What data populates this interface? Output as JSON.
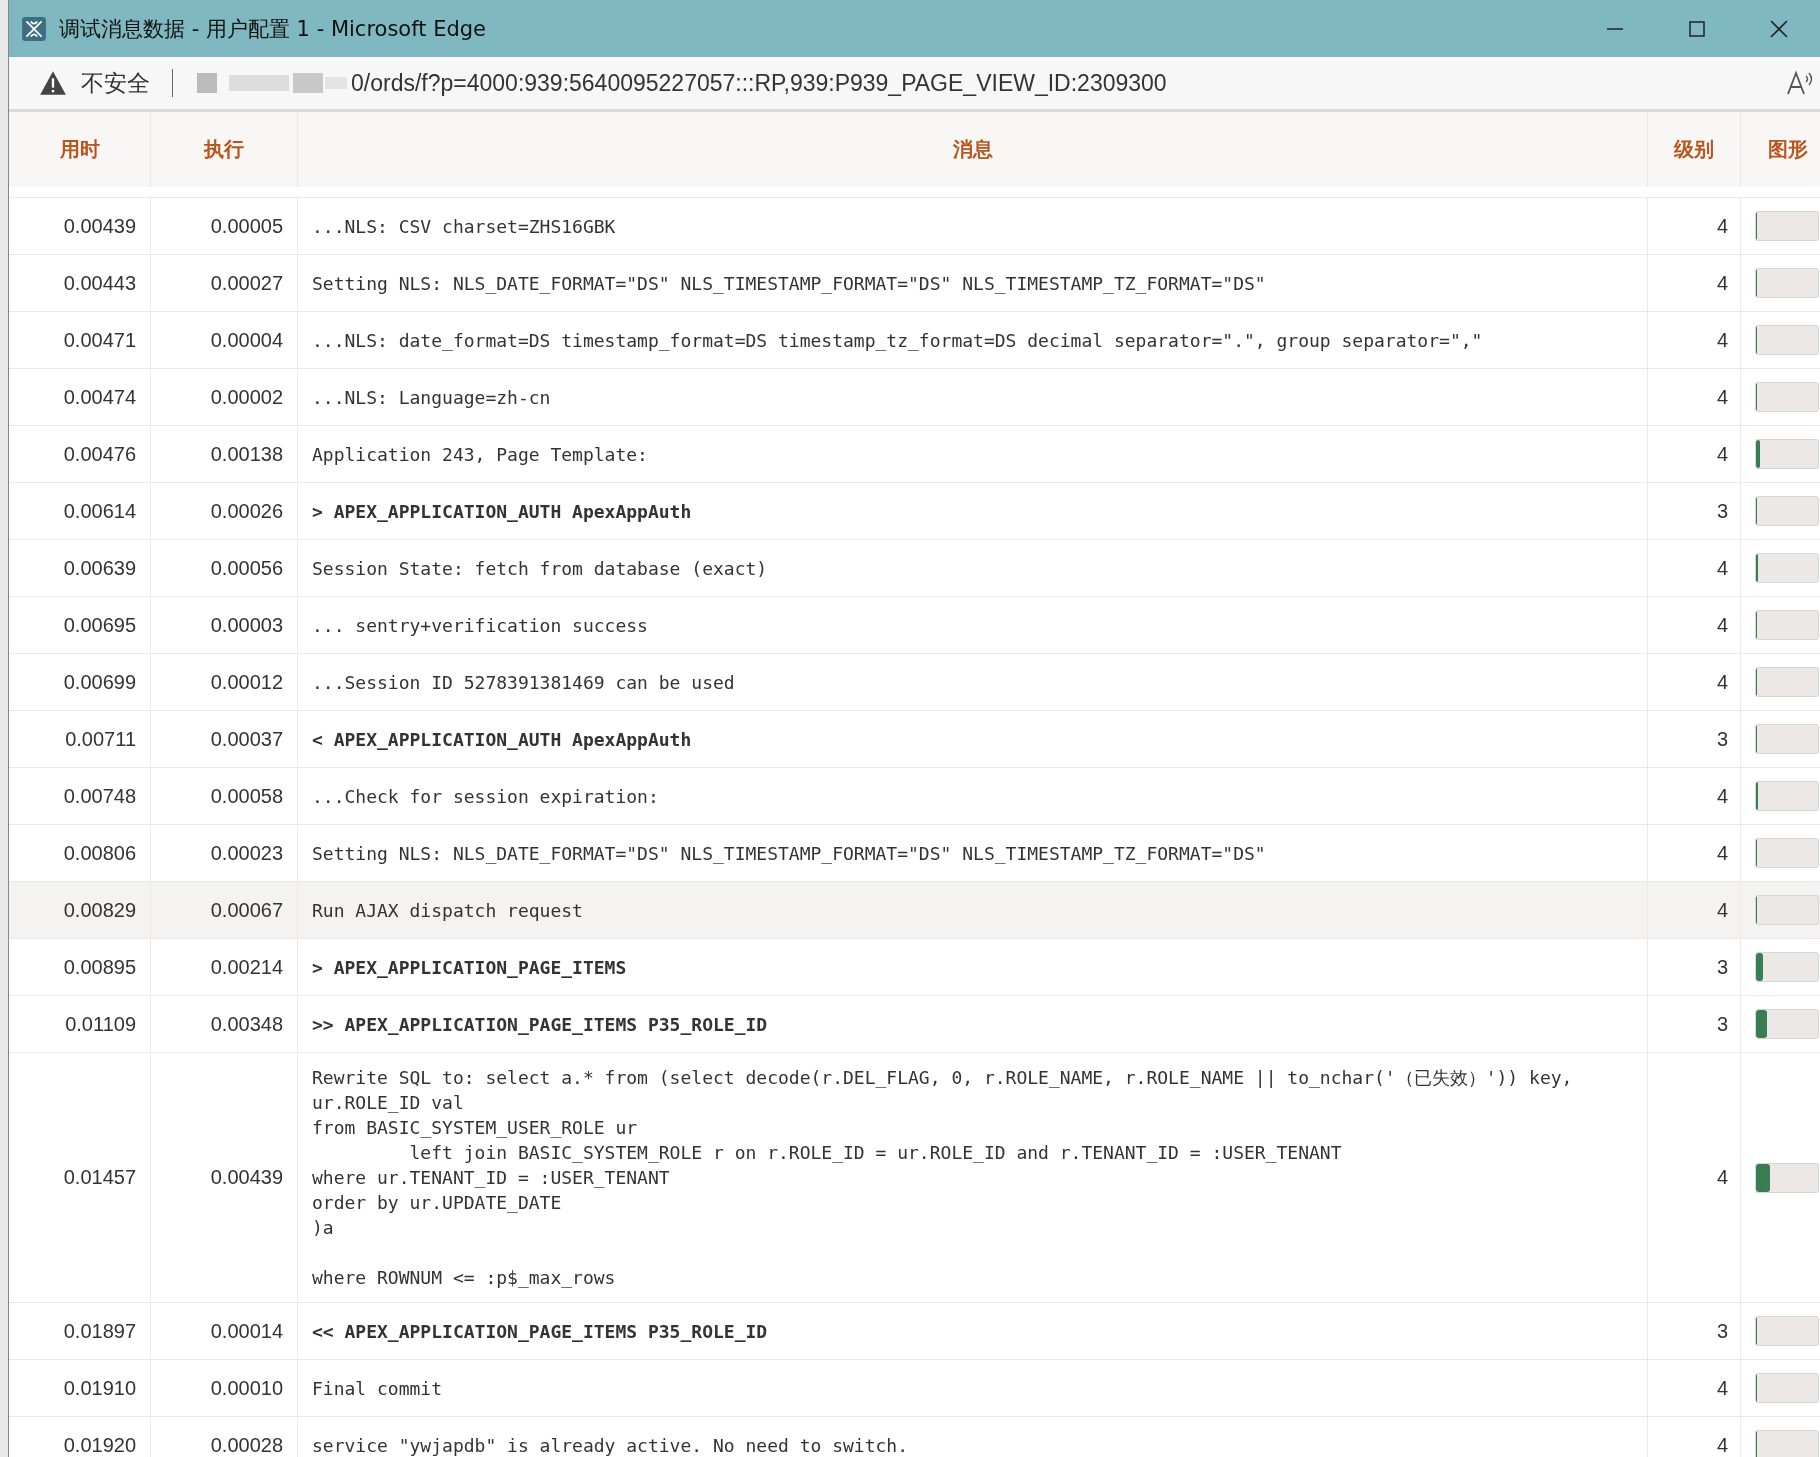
{
  "window": {
    "title": "调试消息数据 - 用户配置 1 - Microsoft Edge"
  },
  "address_bar": {
    "security": "不安全",
    "url": "0/ords/f?p=4000:939:5640095227057:::RP,939:P939_PAGE_VIEW_ID:2309300"
  },
  "table": {
    "columns": [
      "用时",
      "执行",
      "消息",
      "级别",
      "图形"
    ],
    "rows": [
      {
        "elapsed": "0.00439",
        "execution": "0.00005",
        "message": "...NLS: CSV charset=ZHS16GBK",
        "level_text": "4",
        "kind": "normal",
        "selected": false,
        "level": 0.003
      },
      {
        "elapsed": "0.00443",
        "execution": "0.00027",
        "message": "Setting NLS: NLS_DATE_FORMAT=\"DS\" NLS_TIMESTAMP_FORMAT=\"DS\" NLS_TIMESTAMP_TZ_FORMAT=\"DS\"",
        "level_text": "4",
        "kind": "normal",
        "selected": false,
        "level": 0.015
      },
      {
        "elapsed": "0.00471",
        "execution": "0.00004",
        "message": "...NLS: date_format=DS timestamp_format=DS timestamp_tz_format=DS decimal separator=\".\", group separator=\",\"",
        "level_text": "4",
        "kind": "normal",
        "selected": false,
        "level": 0.003
      },
      {
        "elapsed": "0.00474",
        "execution": "0.00002",
        "message": "...NLS: Language=zh-cn",
        "level_text": "4",
        "kind": "normal",
        "selected": false,
        "level": 0.001
      },
      {
        "elapsed": "0.00476",
        "execution": "0.00138",
        "message": "Application 243, Page Template:",
        "level_text": "4",
        "kind": "normal",
        "selected": false,
        "level": 0.06
      },
      {
        "elapsed": "0.00614",
        "execution": "0.00026",
        "message": "> APEX_APPLICATION_AUTH ApexAppAuth",
        "level_text": "3",
        "kind": "section",
        "selected": false,
        "level": 0.015
      },
      {
        "elapsed": "0.00639",
        "execution": "0.00056",
        "message": "Session State: fetch from database (exact)",
        "level_text": "4",
        "kind": "normal",
        "selected": false,
        "level": 0.03
      },
      {
        "elapsed": "0.00695",
        "execution": "0.00003",
        "message": "... sentry+verification success",
        "level_text": "4",
        "kind": "normal",
        "selected": false,
        "level": 0.002
      },
      {
        "elapsed": "0.00699",
        "execution": "0.00012",
        "message": "...Session ID 5278391381469 can be used",
        "level_text": "4",
        "kind": "normal",
        "selected": false,
        "level": 0.01
      },
      {
        "elapsed": "0.00711",
        "execution": "0.00037",
        "message": "< APEX_APPLICATION_AUTH ApexAppAuth",
        "level_text": "3",
        "kind": "section",
        "selected": false,
        "level": 0.02
      },
      {
        "elapsed": "0.00748",
        "execution": "0.00058",
        "message": "...Check for session expiration:",
        "level_text": "4",
        "kind": "normal",
        "selected": false,
        "level": 0.03
      },
      {
        "elapsed": "0.00806",
        "execution": "0.00023",
        "message": "Setting NLS: NLS_DATE_FORMAT=\"DS\" NLS_TIMESTAMP_FORMAT=\"DS\" NLS_TIMESTAMP_TZ_FORMAT=\"DS\"",
        "level_text": "4",
        "kind": "normal",
        "selected": false,
        "level": 0.015
      },
      {
        "elapsed": "0.00829",
        "execution": "0.00067",
        "message": "Run AJAX dispatch request",
        "level_text": "4",
        "kind": "normal",
        "selected": true,
        "level": 0.02
      },
      {
        "elapsed": "0.00895",
        "execution": "0.00214",
        "message": "> APEX_APPLICATION_PAGE_ITEMS",
        "level_text": "3",
        "kind": "section",
        "selected": false,
        "level": 0.11
      },
      {
        "elapsed": "0.01109",
        "execution": "0.00348",
        "message": ">> APEX_APPLICATION_PAGE_ITEMS P35_ROLE_ID",
        "level_text": "3",
        "kind": "section",
        "selected": false,
        "level": 0.18
      },
      {
        "elapsed": "0.01457",
        "execution": "0.00439",
        "message": "Rewrite SQL to: select a.* from (select decode(r.DEL_FLAG, 0, r.ROLE_NAME, r.ROLE_NAME || to_nchar('（已失效）')) key,\nur.ROLE_ID val\nfrom BASIC_SYSTEM_USER_ROLE ur\n         left join BASIC_SYSTEM_ROLE r on r.ROLE_ID = ur.ROLE_ID and r.TENANT_ID = :USER_TENANT\nwhere ur.TENANT_ID = :USER_TENANT\norder by ur.UPDATE_DATE\n)a\n\nwhere ROWNUM <= :p$_max_rows",
        "level_text": "4",
        "kind": "normal",
        "selected": false,
        "level": 0.23
      },
      {
        "elapsed": "0.01897",
        "execution": "0.00014",
        "message": "<< APEX_APPLICATION_PAGE_ITEMS P35_ROLE_ID",
        "level_text": "3",
        "kind": "section",
        "selected": false,
        "level": 0.01
      },
      {
        "elapsed": "0.01910",
        "execution": "0.00010",
        "message": "Final commit",
        "level_text": "4",
        "kind": "normal",
        "selected": false,
        "level": 0.0
      },
      {
        "elapsed": "0.01920",
        "execution": "0.00028",
        "message": "service \"ywjapdb\" is already active. No need to switch.",
        "level_text": "4",
        "kind": "normal",
        "selected": false,
        "level": 0.015
      }
    ]
  }
}
